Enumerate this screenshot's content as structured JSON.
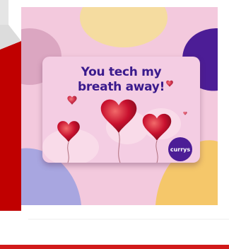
{
  "product": {
    "card_headline_line1": "You tech my",
    "card_headline_line2": "breath away!",
    "brand_badge": "currys"
  },
  "colors": {
    "image_background": "#f3c9dd",
    "headline": "#3a1a8c",
    "brand_badge": "#4c1d96",
    "heart": "#c8102e",
    "page_side_strip": "#c00000"
  },
  "icons": [
    "heart-balloon-icon"
  ]
}
